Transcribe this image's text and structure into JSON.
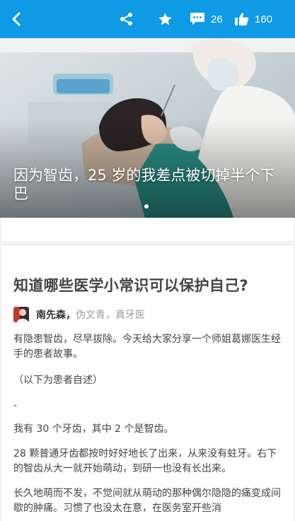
{
  "toolbar": {
    "comment_count": "26",
    "like_count": "160"
  },
  "hero": {
    "title": "因为智齿，25 岁的我差点被切掉半个下巴"
  },
  "answer": {
    "question_title": "知道哪些医学小常识可以保护自己?",
    "author_name": "南先森，",
    "author_bio": "伪文青，真牙医",
    "paragraphs": [
      "有隐患智齿，尽早拔除。今天给大家分享一个师姐葛娜医生经手的患者故事。",
      "（以下为患者自述）",
      "-",
      "我有 30 个牙齿，其中 2 个是智齿。",
      "28 颗普通牙齿都按时好好地长了出来，从来没有蛀牙。右下的智齿从大一就开始萌动，到研一也没有长出来。",
      "长久地萌而不发，不觉间就从萌动的那种偶尔隐隐的痛变成间歇的肿痛。习惯了也没太在意，在医务室开些消"
    ]
  },
  "colors": {
    "accent": "#0f9ae5",
    "title_text": "#444444",
    "muted_text": "#999999"
  }
}
